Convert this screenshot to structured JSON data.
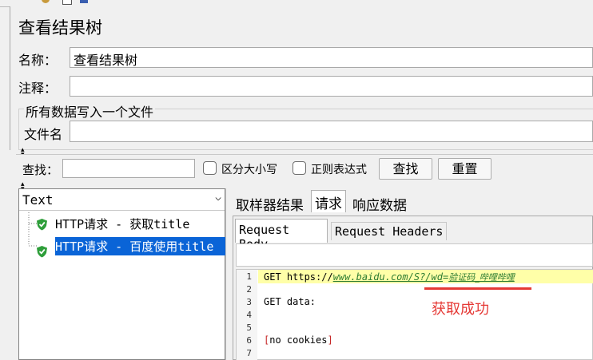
{
  "panel": {
    "title": "查看结果树",
    "name_label": "名称：",
    "name_value": "查看结果树",
    "comment_label": "注释：",
    "comment_value": "",
    "file_group_title": "所有数据写入一个文件",
    "file_label": "文件名",
    "file_value": ""
  },
  "search": {
    "label": "查找：",
    "value": "",
    "case_label": "区分大小写",
    "regex_label": "正则表达式",
    "find_button": "查找",
    "reset_button": "重置"
  },
  "results": {
    "renderer": "Text",
    "tree": [
      {
        "label": "HTTP请求 - 获取title",
        "status": "success",
        "selected": false
      },
      {
        "label": "HTTP请求 - 百度使用title",
        "status": "success",
        "selected": true
      }
    ]
  },
  "tabs": {
    "main": [
      "取样器结果",
      "请求",
      "响应数据"
    ],
    "main_selected": "请求",
    "sub": [
      "Request Body",
      "Request Headers"
    ],
    "sub_selected": "Request Body"
  },
  "editor": {
    "line_numbers": [
      "1",
      "2",
      "3",
      "4",
      "5",
      "6",
      "7"
    ],
    "line1_prefix": "GET https://",
    "line1_url": "www.baidu.com/S?/wd",
    "line1_eq": "=",
    "line1_param": "验证码_哔哩哔哩",
    "line3": "GET data:",
    "line6_open": "[",
    "line6_text": "no cookies",
    "line6_close": "]"
  },
  "annotation": {
    "text": "获取成功",
    "color": "#e53935"
  },
  "colors": {
    "selection": "#0a64d7",
    "success_icon": "#2e9e3a",
    "highlight_line": "#ffffa8",
    "link": "#2e7d32",
    "bracket": "#c62828"
  }
}
